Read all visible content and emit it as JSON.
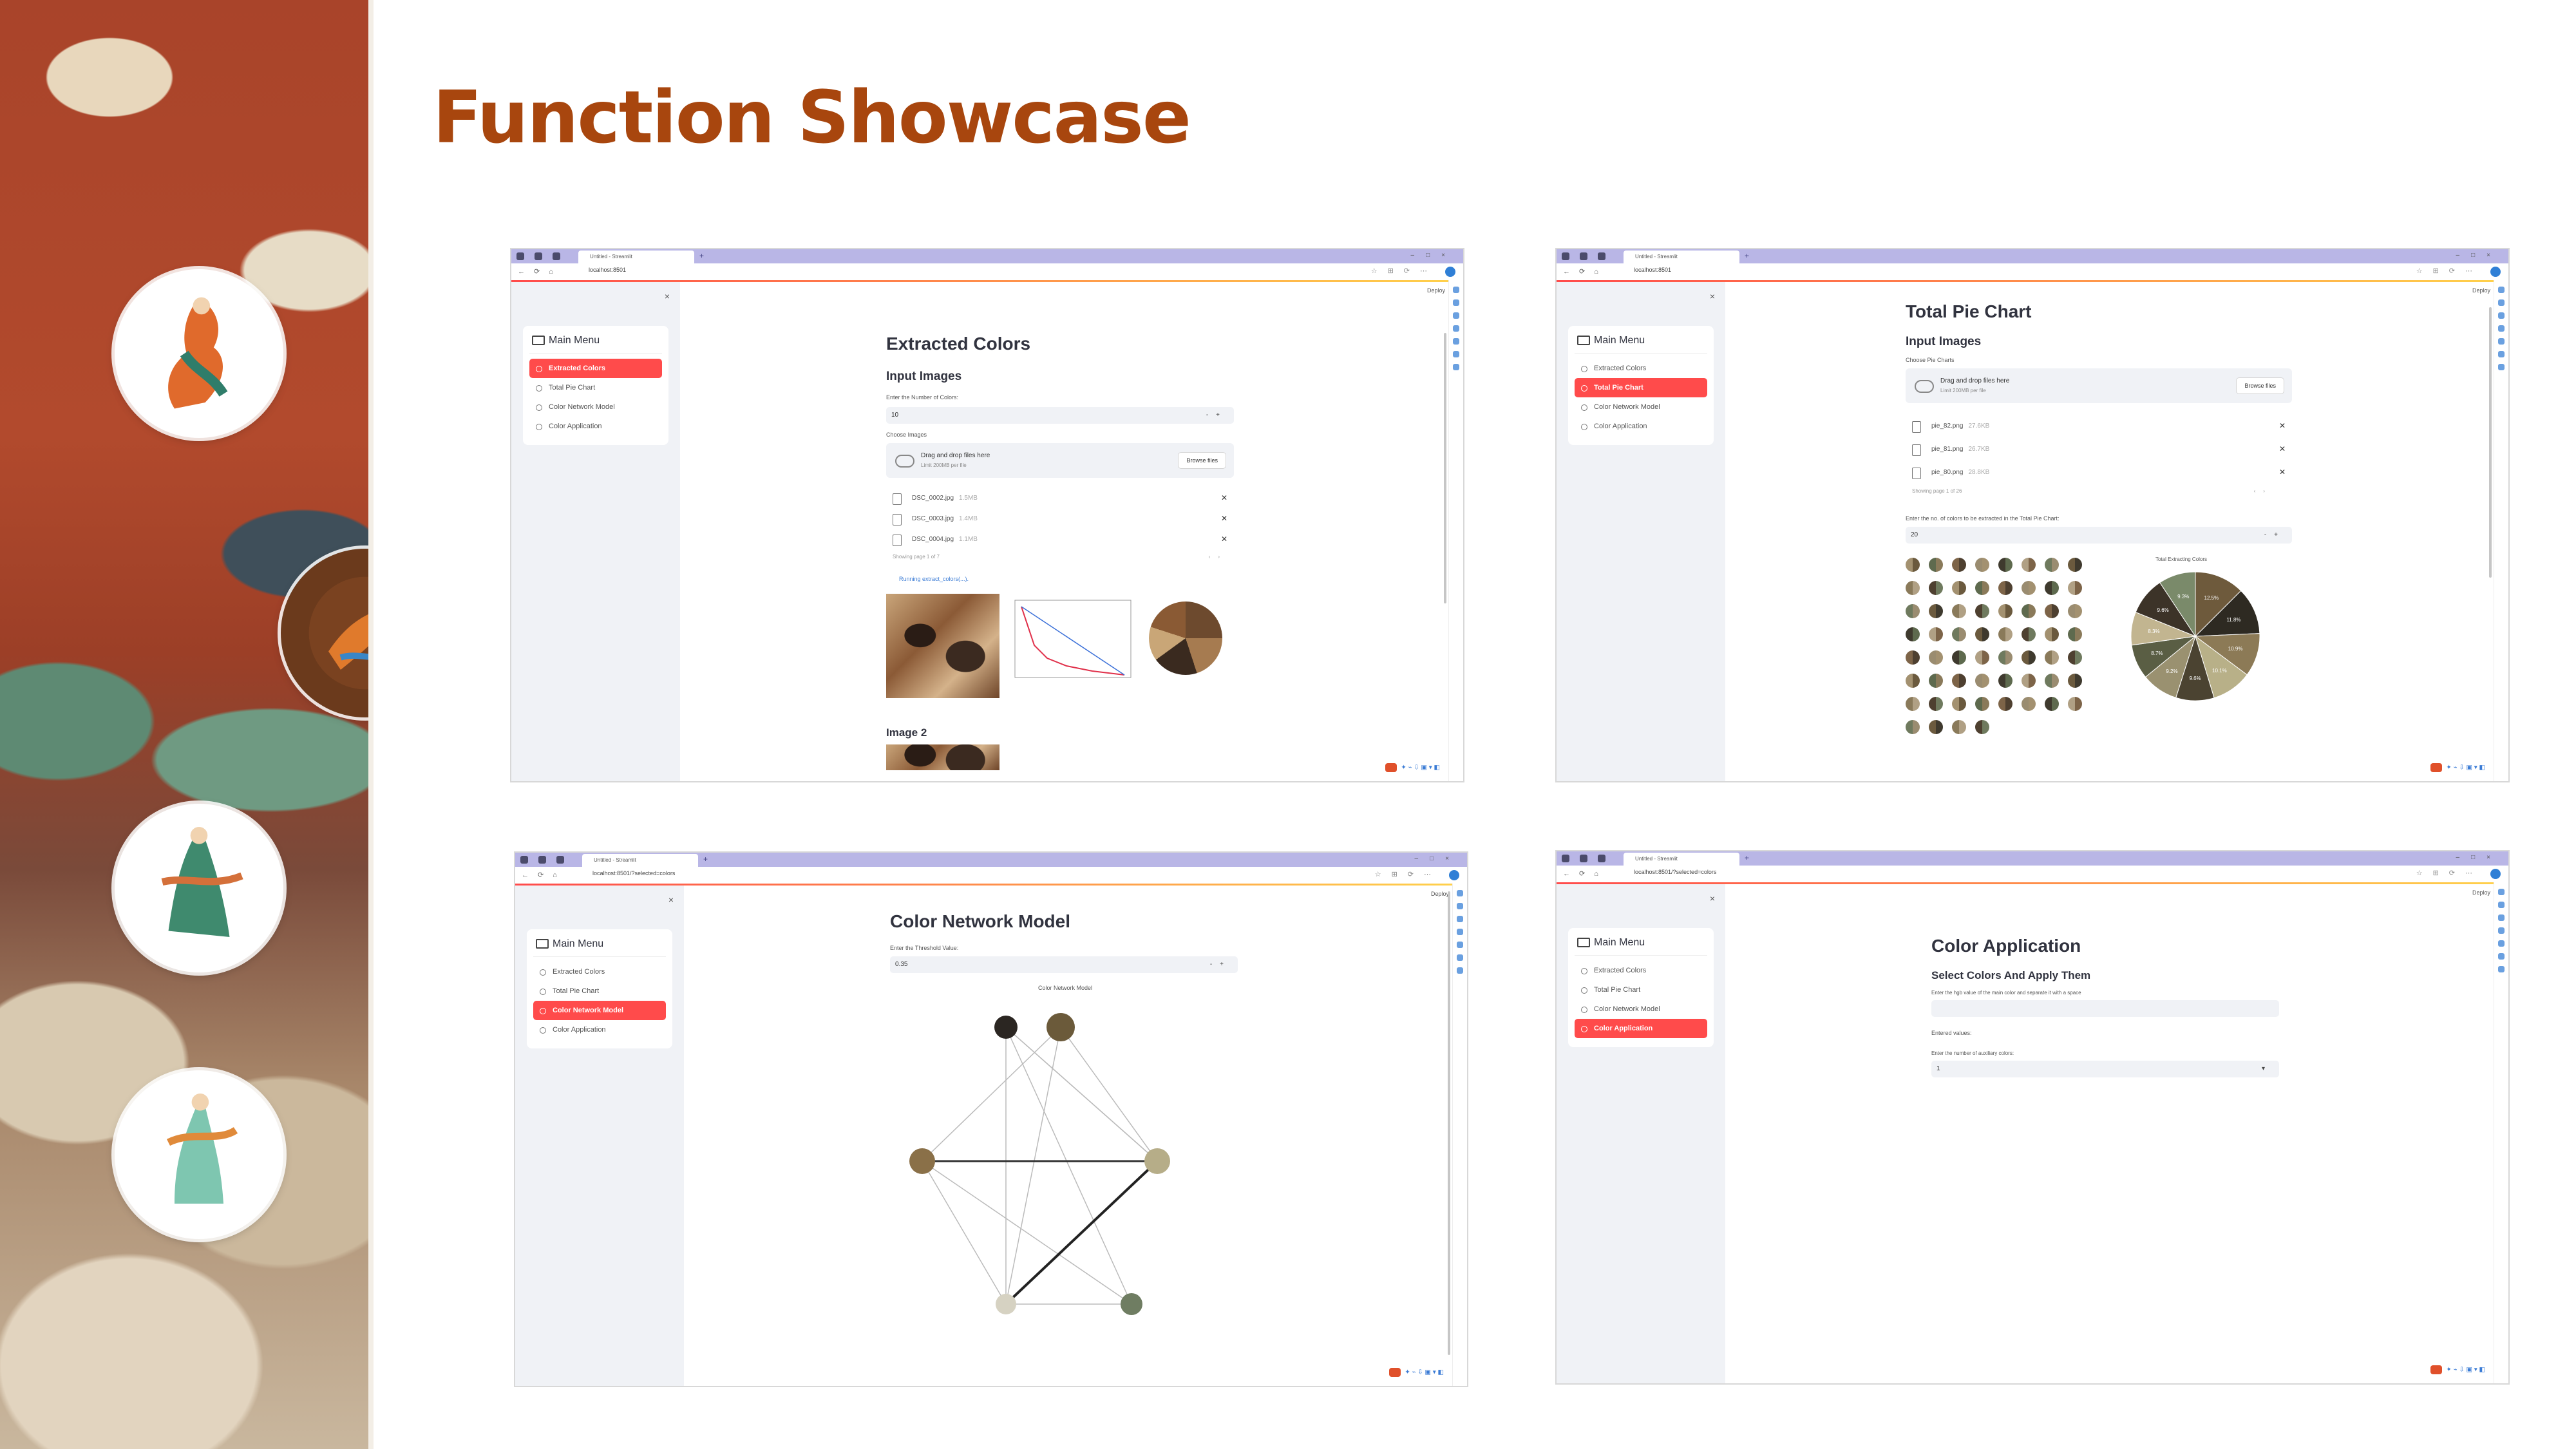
{
  "slide": {
    "title": "Function Showcase"
  },
  "browser": {
    "tab_title": "Untitled - Streamlit",
    "url_home": "localhost:8501",
    "url_network": "localhost:8501/?selected=colors",
    "deploy_label": "Deploy"
  },
  "menu": {
    "title": "Main Menu",
    "items": [
      "Extracted Colors",
      "Total Pie Chart",
      "Color Network Model",
      "Color Application"
    ]
  },
  "panel1": {
    "heading": "Extracted Colors",
    "subheading": "Input Images",
    "num_label": "Enter the Number of Colors:",
    "num_value": "10",
    "choose_label": "Choose Images",
    "drop_title": "Drag and drop files here",
    "drop_limit": "Limit 200MB per file",
    "browse": "Browse files",
    "files": [
      {
        "name": "DSC_0002.jpg",
        "size": "1.5MB"
      },
      {
        "name": "DSC_0003.jpg",
        "size": "1.4MB"
      },
      {
        "name": "DSC_0004.jpg",
        "size": "1.1MB"
      }
    ],
    "pager": "Showing page 1 of 7",
    "running": "Running extract_colors(...).",
    "image2": "Image 2"
  },
  "panel2": {
    "heading": "Total Pie Chart",
    "subheading": "Input Images",
    "choose_label": "Choose Pie Charts",
    "drop_title": "Drag and drop files here",
    "drop_limit": "Limit 200MB per file",
    "browse": "Browse files",
    "files": [
      {
        "name": "pie_82.png",
        "size": "27.6KB"
      },
      {
        "name": "pie_81.png",
        "size": "26.7KB"
      },
      {
        "name": "pie_80.png",
        "size": "28.8KB"
      }
    ],
    "pager": "Showing page 1 of 26",
    "count_label": "Enter the no. of colors to be extracted in the Total Pie Chart:",
    "count_value": "20",
    "pie_title": "Total Extracting Colors",
    "swatch_colors": [
      "#6b5a3e",
      "#8a7a5a",
      "#4e4030",
      "#a39170",
      "#5e6a4e",
      "#7d6448",
      "#9a8c70",
      "#3f3a2e",
      "#b0a084",
      "#6f7a5e"
    ],
    "pie_slices": [
      {
        "value": 12.5,
        "color": "#6e5a3c"
      },
      {
        "value": 11.8,
        "color": "#2e2a22"
      },
      {
        "value": 10.9,
        "color": "#8c7a56"
      },
      {
        "value": 10.1,
        "color": "#b8b088"
      },
      {
        "value": 9.6,
        "color": "#4b4331"
      },
      {
        "value": 9.2,
        "color": "#9a9170"
      },
      {
        "value": 8.7,
        "color": "#5a5e44"
      },
      {
        "value": 8.3,
        "color": "#c2b590"
      },
      {
        "value": 9.6,
        "color": "#3c3328"
      },
      {
        "value": 9.3,
        "color": "#7a8a6a"
      }
    ]
  },
  "panel3": {
    "heading": "Color Network Model",
    "threshold_label": "Enter the Threshold Value:",
    "threshold_value": "0.35",
    "graph_title": "Color Network Model",
    "nodes": [
      {
        "id": "n1",
        "color": "#2b2622"
      },
      {
        "id": "n2",
        "color": "#6b5a3a"
      },
      {
        "id": "n3",
        "color": "#8a7048"
      },
      {
        "id": "n4",
        "color": "#b6ad88"
      },
      {
        "id": "n5",
        "color": "#d6d2c2"
      },
      {
        "id": "n6",
        "color": "#6f7d62"
      }
    ]
  },
  "panel4": {
    "heading": "Color Application",
    "subheading": "Select Colors And Apply Them",
    "hex_label": "Enter the hgb value of the main color and separate it with a space",
    "entered_label": "Entered values:",
    "aux_label": "Enter the number of auxiliary colors:",
    "aux_value": "1"
  }
}
